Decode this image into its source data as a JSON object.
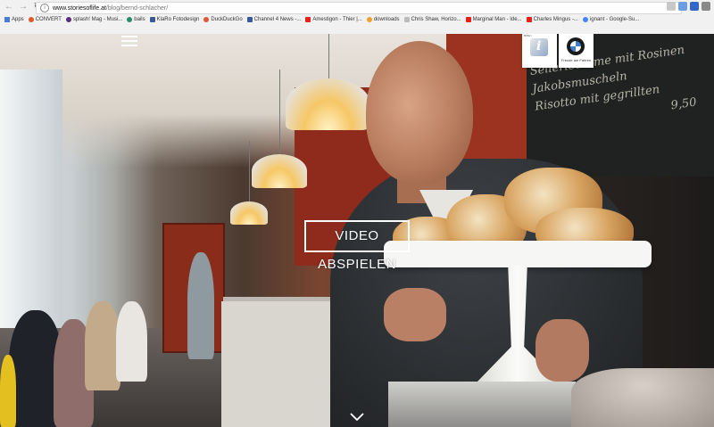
{
  "browser": {
    "url_domain": "www.storiesoflife.at",
    "url_path": "/blog/bernd-schlacher/",
    "bookmarks": [
      {
        "label": "Apps",
        "icon": "apps-grid-icon",
        "color": "#4a7bd8"
      },
      {
        "label": "CONVERT",
        "icon": "convert-icon",
        "color": "#e05a2a"
      },
      {
        "label": "splash! Mag - Musi...",
        "icon": "splash-icon",
        "color": "#5a2d7a"
      },
      {
        "label": "bails",
        "icon": "bails-icon",
        "color": "#2b8a6a"
      },
      {
        "label": "KlaRo Fotodesign",
        "icon": "facebook-icon",
        "color": "#3b5998"
      },
      {
        "label": "DuckDuckGo",
        "icon": "duckduckgo-icon",
        "color": "#de5833"
      },
      {
        "label": "Channel 4 News -...",
        "icon": "facebook-icon",
        "color": "#3b5998"
      },
      {
        "label": "Amestigon - Thier |...",
        "icon": "youtube-icon",
        "color": "#e62117"
      },
      {
        "label": "downloads",
        "icon": "downloads-icon",
        "color": "#f0a030"
      },
      {
        "label": "Chris Shaw, Horizo...",
        "icon": "page-icon",
        "color": "#bbbbbb"
      },
      {
        "label": "Marginal Man - Ide...",
        "icon": "youtube-icon",
        "color": "#e62117"
      },
      {
        "label": "Charles Mingus -...",
        "icon": "youtube-icon",
        "color": "#e62117"
      },
      {
        "label": "ignant - Google-Su...",
        "icon": "google-icon",
        "color": "#4285f4"
      }
    ]
  },
  "page": {
    "video_button_label": "VIDEO ABSPIELEN",
    "bmw_caption": "Freude am Fahren",
    "badge_i_letter": "i",
    "badge_top_label": "BMW i",
    "chalkboard_lines": [
      "Selleriecreme mit Rosinen",
      "Jakobsmuscheln",
      "Risotto mit gegrillten",
      "9,50"
    ]
  },
  "colors": {
    "accent_white": "#ffffff",
    "bmw_blue": "#3c7fd1"
  }
}
